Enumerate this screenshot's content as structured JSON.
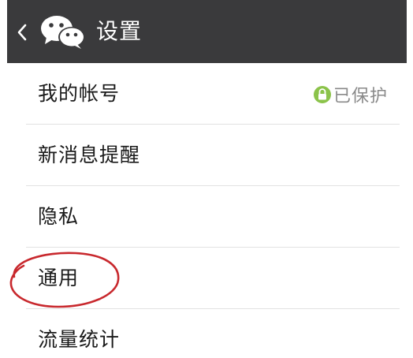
{
  "header": {
    "title": "设置",
    "back_icon": "chevron-left-icon",
    "logo_icon": "wechat-logo-icon",
    "background": "#3a3a3c"
  },
  "settings": {
    "items": [
      {
        "label": "我的帐号",
        "status": "已保护",
        "status_icon": "lock-icon",
        "status_color": "#8bc34a"
      },
      {
        "label": "新消息提醒"
      },
      {
        "label": "隐私"
      },
      {
        "label": "通用",
        "highlighted": true
      },
      {
        "label": "流量统计"
      }
    ]
  },
  "annotation": {
    "shape": "ellipse",
    "color": "#c8282d",
    "target": "通用"
  }
}
